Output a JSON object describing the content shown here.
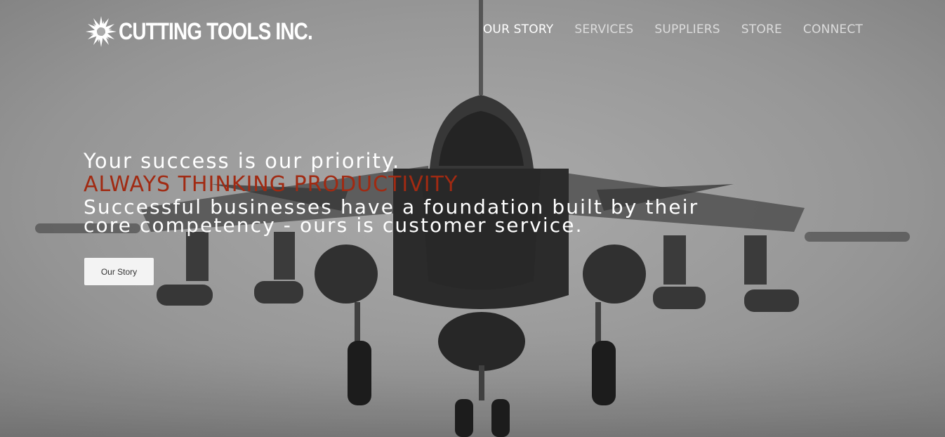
{
  "brand": {
    "name": "CUTTING TOOLS INC."
  },
  "nav": {
    "items": [
      {
        "label": "OUR STORY",
        "active": true
      },
      {
        "label": "SERVICES",
        "active": false
      },
      {
        "label": "SUPPLIERS",
        "active": false
      },
      {
        "label": "STORE",
        "active": false
      },
      {
        "label": "CONNECT",
        "active": false
      }
    ]
  },
  "hero": {
    "tagline": "Your success is our priority.",
    "headline": "ALWAYS THINKING PRODUCTIVITY",
    "description": "Successful businesses have a foundation built by their core competency - ours is customer service.",
    "cta_label": "Our Story",
    "background_image": "fighter-jet-on-foggy-runway"
  },
  "colors": {
    "accent": "#a12a12",
    "nav_text": "#dcdcdc",
    "nav_active": "#ffffff",
    "button_bg": "#f3f3f3"
  }
}
